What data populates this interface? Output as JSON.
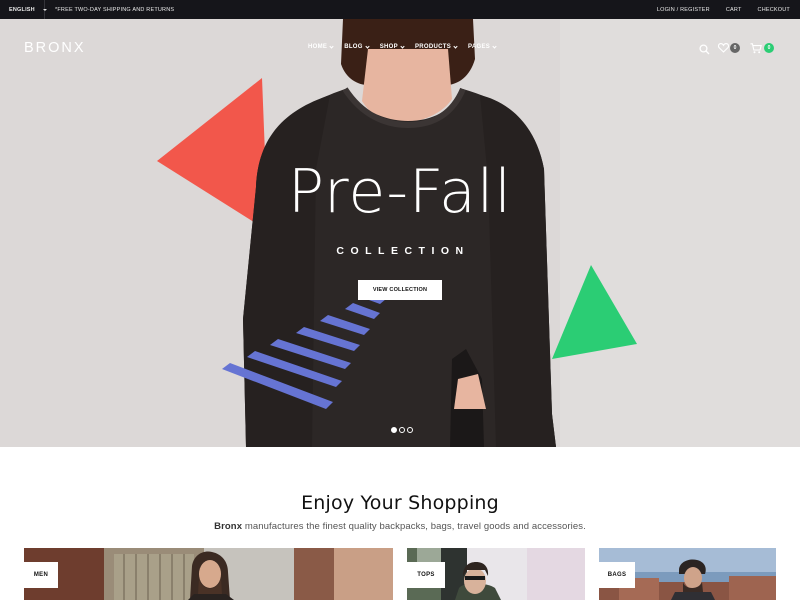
{
  "topbar": {
    "language": "ENGLISH",
    "promo": "*FREE TWO-DAY SHIPPING AND RETURNS",
    "login": "LOGIN / REGISTER",
    "cart": "CART",
    "checkout": "CHECKOUT"
  },
  "header": {
    "logo": "BRONX",
    "nav": [
      "HOME",
      "BLOG",
      "SHOP",
      "PRODUCTS",
      "PAGES"
    ],
    "wishlist_count": "0",
    "cart_count": "0"
  },
  "hero": {
    "title": "Pre-Fall",
    "subtitle": "COLLECTION",
    "button": "VIEW COLLECTION",
    "slide_count": 3,
    "active_slide": 1
  },
  "section": {
    "title": "Enjoy Your Shopping",
    "brand": "Bronx",
    "description": " manufactures the finest quality backpacks, bags, travel goods and accessories."
  },
  "categories": [
    {
      "label": "MEN"
    },
    {
      "label": "TOPS"
    },
    {
      "label": "BAGS"
    }
  ],
  "colors": {
    "topbar": "#15151a",
    "hero_bg": "#dcd8d7",
    "triangle_red": "#f2574b",
    "triangle_green": "#2bcd74",
    "stripes": "#6674d3",
    "cart_badge": "#2bcd74",
    "wishlist_badge": "#666666"
  }
}
